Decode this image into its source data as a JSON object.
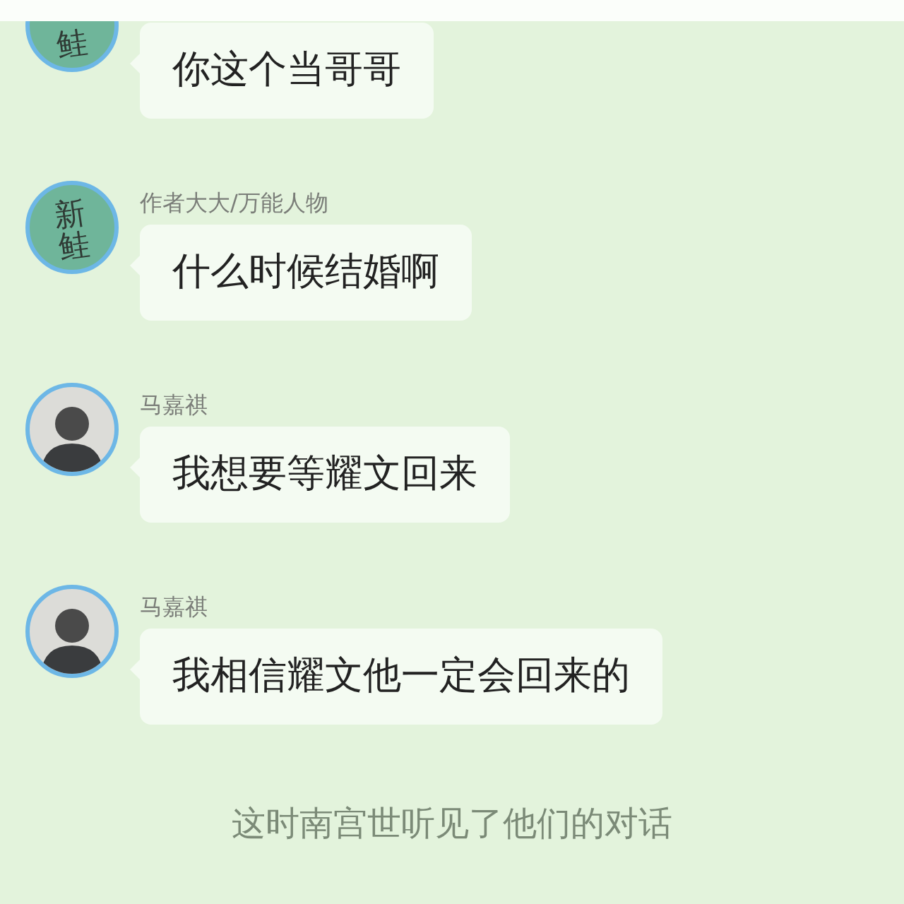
{
  "messages": [
    {
      "kind": "message",
      "avatar": {
        "kind": "logo",
        "text": "鲑"
      },
      "text": "你这个当哥哥"
    },
    {
      "kind": "message",
      "avatar": {
        "kind": "logo",
        "text": "新鲑"
      },
      "name": "作者大大/万能人物",
      "text": "什么时候结婚啊"
    },
    {
      "kind": "message",
      "avatar": {
        "kind": "person"
      },
      "name": "马嘉祺",
      "text": "我想要等耀文回来"
    },
    {
      "kind": "message",
      "avatar": {
        "kind": "person"
      },
      "name": "马嘉祺",
      "text": "我相信耀文他一定会回来的"
    },
    {
      "kind": "narration",
      "text": "这时南宫世听见了他们的对话"
    }
  ]
}
